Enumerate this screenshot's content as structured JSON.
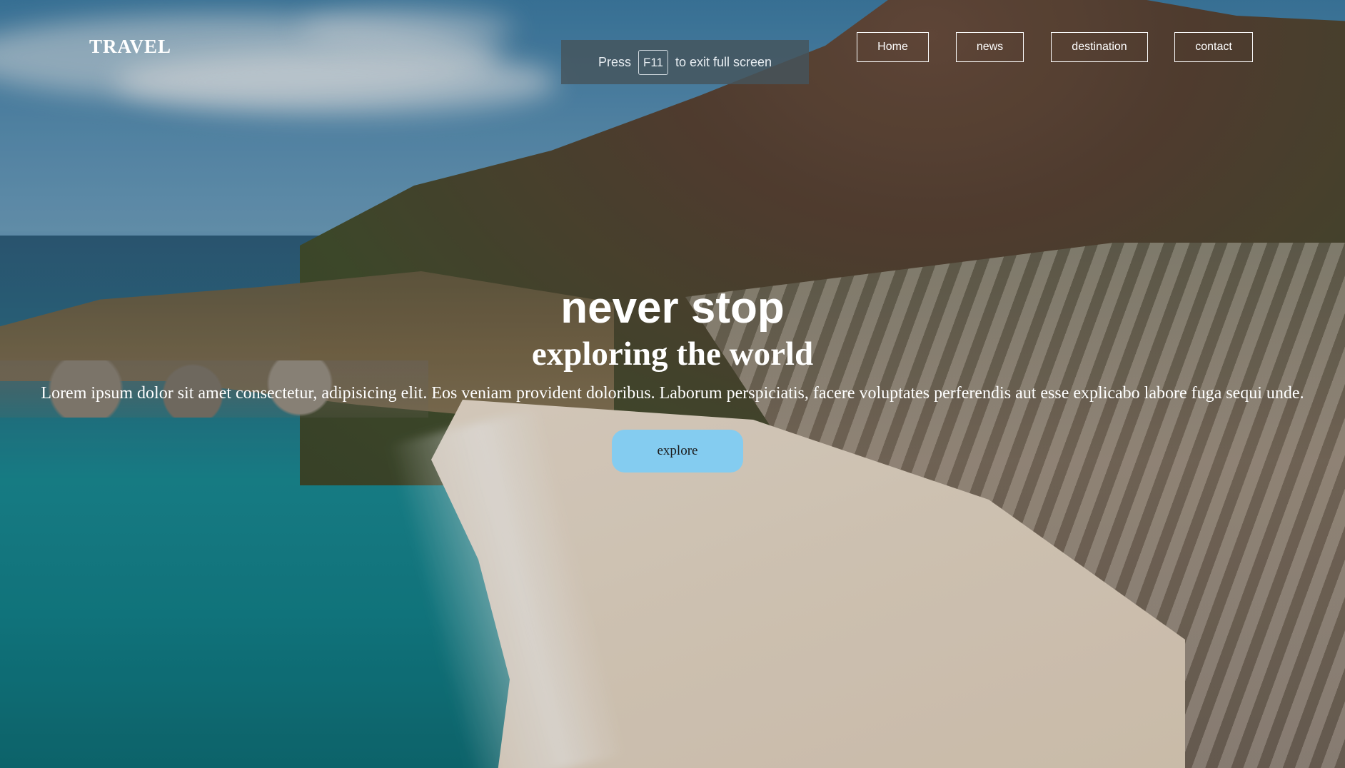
{
  "header": {
    "logo": "TRAVEL",
    "nav": [
      {
        "label": "Home"
      },
      {
        "label": "news"
      },
      {
        "label": "destination"
      },
      {
        "label": "contact"
      }
    ]
  },
  "fullscreen_notice": {
    "prefix": "Press",
    "key": "F11",
    "suffix": "to exit full screen"
  },
  "hero": {
    "title": "never stop",
    "subtitle": "exploring the world",
    "text": "Lorem ipsum dolor sit amet consectetur, adipisicing elit. Eos veniam provident doloribus. Laborum perspiciatis, facere voluptates perferendis aut esse explicabo labore fuga sequi unde.",
    "button_label": "explore"
  },
  "colors": {
    "button": "#84ccf0",
    "text": "#ffffff"
  }
}
